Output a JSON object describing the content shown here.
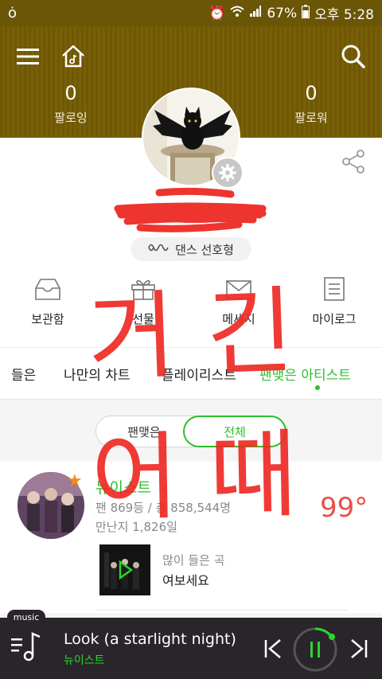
{
  "status_bar": {
    "battery": "67%",
    "time": "오후 5:28"
  },
  "header": {
    "following_count": "0",
    "following_label": "팔로잉",
    "follower_count": "0",
    "follower_label": "팔로워"
  },
  "profile": {
    "genre_label": "댄스 선호형"
  },
  "menu": {
    "items": [
      {
        "label": "보관함",
        "icon": "inbox-icon"
      },
      {
        "label": "선물",
        "icon": "gift-icon"
      },
      {
        "label": "메세지",
        "icon": "message-icon"
      },
      {
        "label": "마이로그",
        "icon": "log-icon"
      }
    ]
  },
  "tabs": {
    "items": [
      "들은",
      "나만의 차트",
      "플레이리스트",
      "팬맺은 아티스트"
    ],
    "active_index": 3
  },
  "segment": {
    "left_label": "팬맺은",
    "right_label": "전체"
  },
  "artist": {
    "name": "뉴이스트",
    "rank": "팬 869등 / 총 858,544명",
    "days": "만난지 1,826일",
    "temperature": "99°",
    "most_played_label": "많이 들은 곡",
    "most_played_song": "여보세요"
  },
  "player": {
    "badge": "music",
    "song_title": "Look (a starlight night)",
    "song_artist": "뉴이스트"
  },
  "handwriting": {
    "line1": "거 긴",
    "line2": "어 때"
  },
  "colors": {
    "header_brown": "#6f5805",
    "accent_green": "#2bbf2b",
    "temp_red": "#e8504a",
    "scribble_red": "#ee2a24",
    "player_bg": "#2a252b"
  }
}
